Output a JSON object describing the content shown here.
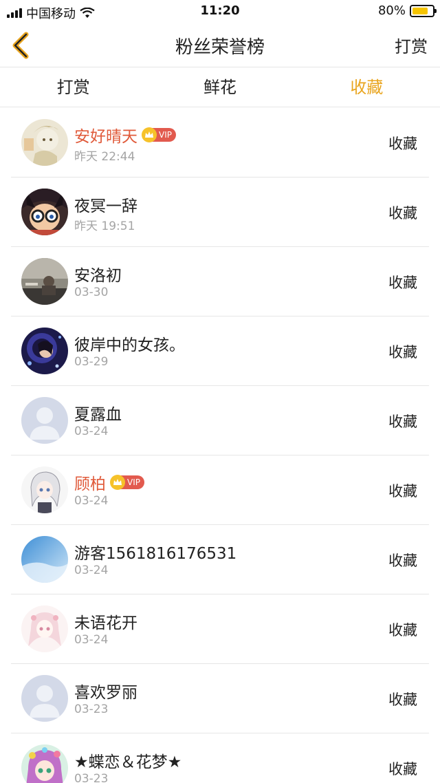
{
  "status_bar": {
    "carrier": "中国移动",
    "time": "11:20",
    "battery": "80%",
    "battery_level": 0.8
  },
  "nav": {
    "title": "粉丝荣誉榜",
    "action": "打赏"
  },
  "tabs": [
    {
      "label": "打赏",
      "active": false
    },
    {
      "label": "鲜花",
      "active": false
    },
    {
      "label": "收藏",
      "active": true
    }
  ],
  "accent_color": "#e9a51f",
  "fans": [
    {
      "name": "安好晴天",
      "vip": true,
      "vip_label": "VIP",
      "date": "昨天 22:44",
      "action": "收藏",
      "avatar": "anime-sketch-avatar"
    },
    {
      "name": "夜冥一辞",
      "vip": false,
      "date": "昨天 19:51",
      "action": "收藏",
      "avatar": "conan-avatar"
    },
    {
      "name": "安洛初",
      "vip": false,
      "date": "03-30",
      "action": "收藏",
      "avatar": "dark-photo-avatar"
    },
    {
      "name": "彼岸中的女孩。",
      "vip": false,
      "date": "03-29",
      "action": "收藏",
      "avatar": "night-girl-avatar"
    },
    {
      "name": "夏露血",
      "vip": false,
      "date": "03-24",
      "action": "收藏",
      "avatar": "default-avatar"
    },
    {
      "name": "顾柏",
      "vip": true,
      "vip_label": "VIP",
      "date": "03-24",
      "action": "收藏",
      "avatar": "white-hair-avatar"
    },
    {
      "name": "游客1561816176531",
      "vip": false,
      "date": "03-24",
      "action": "收藏",
      "avatar": "sky-avatar"
    },
    {
      "name": "未语花开",
      "vip": false,
      "date": "03-24",
      "action": "收藏",
      "avatar": "pink-girl-avatar"
    },
    {
      "name": "喜欢罗丽",
      "vip": false,
      "date": "03-23",
      "action": "收藏",
      "avatar": "default-avatar"
    },
    {
      "name": "★蝶恋＆花梦★",
      "vip": false,
      "date": "03-23",
      "action": "收藏",
      "avatar": "colorful-girl-avatar"
    }
  ]
}
